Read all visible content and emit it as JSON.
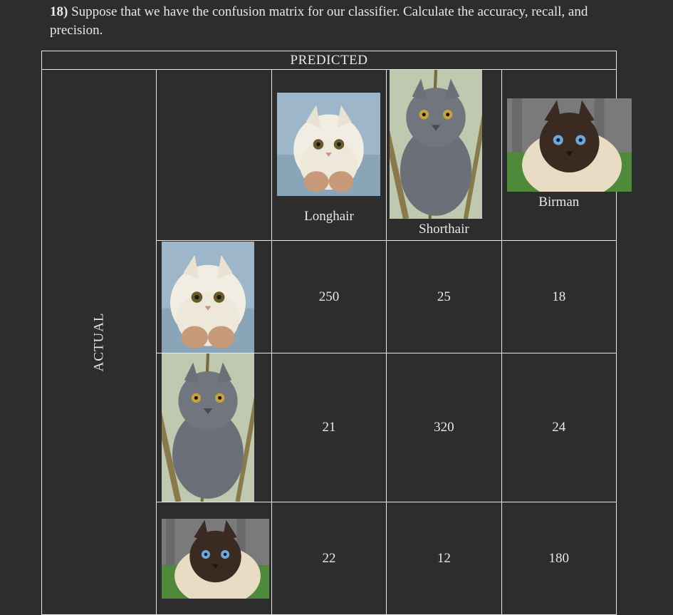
{
  "question": {
    "number": "18)",
    "text": " Suppose that we have the confusion matrix for our classifier. Calculate the accuracy, recall, and precision."
  },
  "headers": {
    "predicted": "PREDICTED",
    "actual": "ACTUAL"
  },
  "classes": [
    {
      "name": "Longhair"
    },
    {
      "name": "Shorthair"
    },
    {
      "name": "Birman"
    }
  ],
  "matrix": [
    [
      250,
      25,
      18
    ],
    [
      21,
      320,
      24
    ],
    [
      22,
      12,
      180
    ]
  ],
  "chart_data": {
    "type": "table",
    "title": "Confusion matrix (rows = ACTUAL, columns = PREDICTED)",
    "categories": [
      "Longhair",
      "Shorthair",
      "Birman"
    ],
    "rows": [
      {
        "actual": "Longhair",
        "predicted": {
          "Longhair": 250,
          "Shorthair": 25,
          "Birman": 18
        }
      },
      {
        "actual": "Shorthair",
        "predicted": {
          "Longhair": 21,
          "Shorthair": 320,
          "Birman": 24
        }
      },
      {
        "actual": "Birman",
        "predicted": {
          "Longhair": 22,
          "Shorthair": 12,
          "Birman": 180
        }
      }
    ]
  }
}
